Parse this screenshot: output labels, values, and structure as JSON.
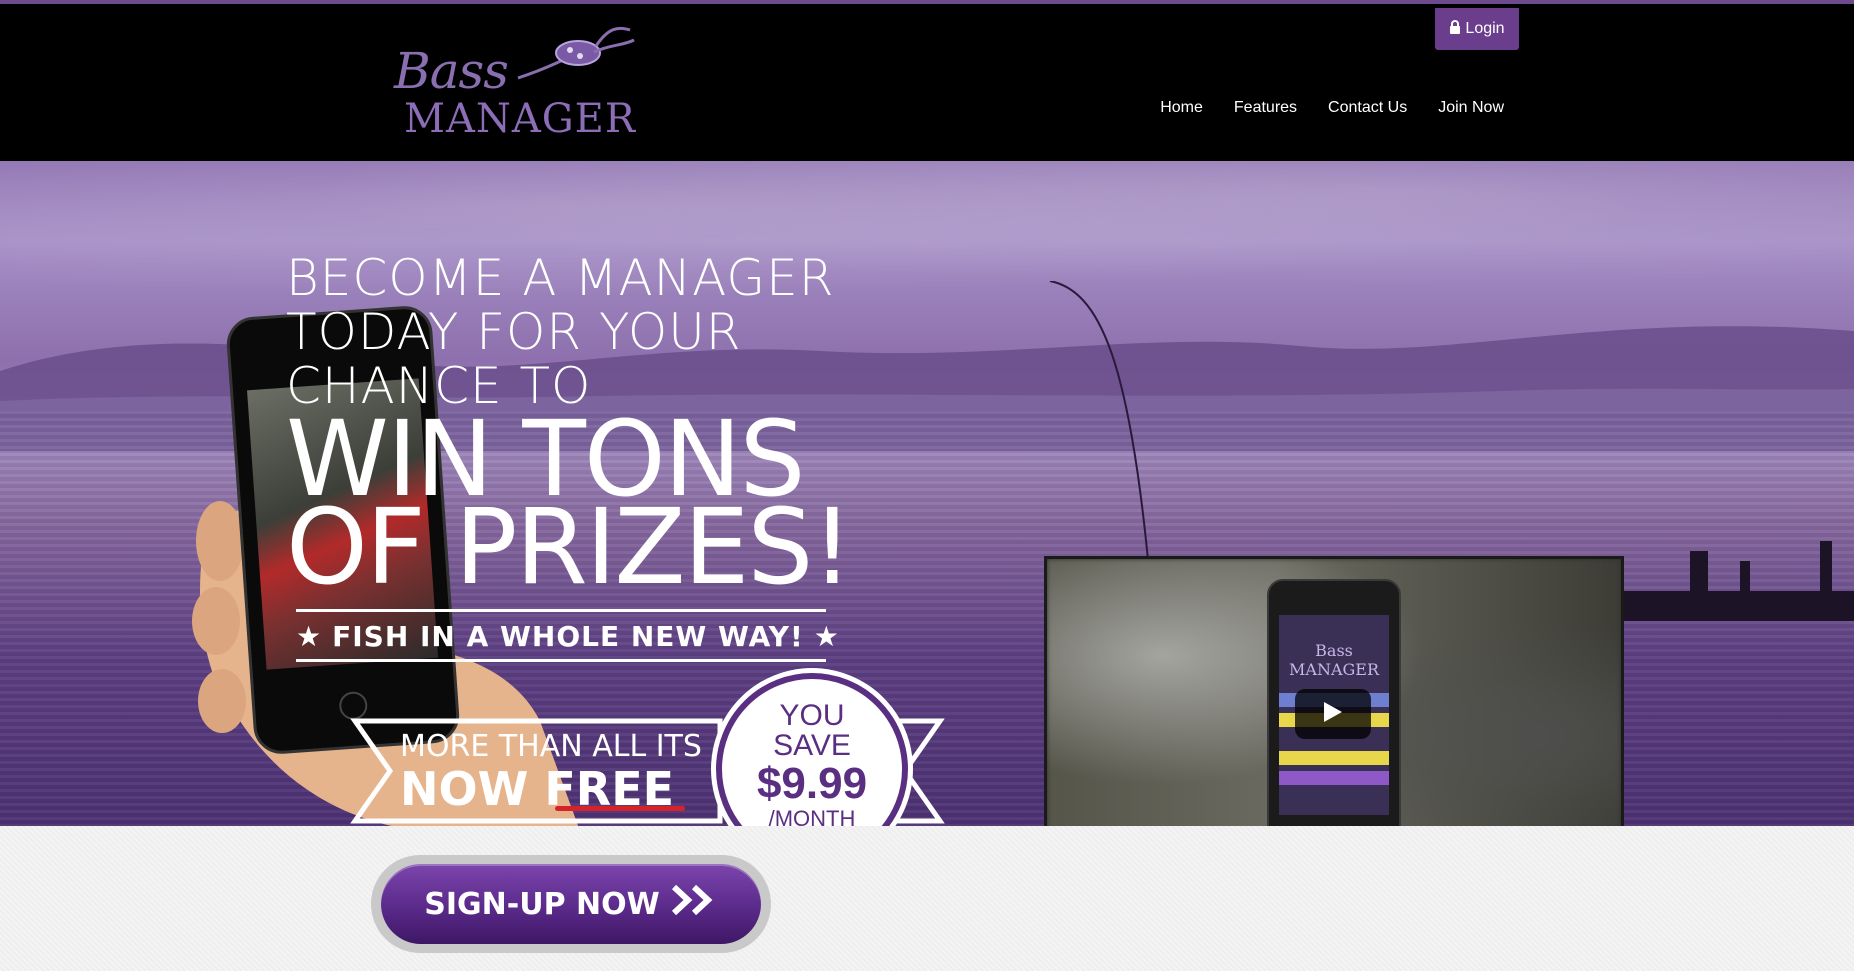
{
  "header": {
    "logo": {
      "line1": "Bass",
      "line2": "MANAGER"
    },
    "login_label": "Login",
    "nav": [
      "Home",
      "Features",
      "Contact Us",
      "Join Now"
    ]
  },
  "hero": {
    "headline_lines": [
      "BECOME A MANAGER",
      "TODAY FOR YOUR",
      "CHANCE TO"
    ],
    "headline_big": [
      "WIN TONS",
      "OF PRIZES!"
    ],
    "tagline": "FISH IN A WHOLE NEW WAY!",
    "ribbon_line1": "MORE THAN ALL ITS",
    "ribbon_line2": "NOW FREE",
    "badge": {
      "line1": "YOU",
      "line2": "SAVE",
      "price": "$9.99",
      "per": "/MONTH"
    },
    "video": {
      "phone_title": "Bass MANAGER"
    }
  },
  "cta": {
    "signup_label": "SIGN-UP NOW"
  },
  "colors": {
    "brand_purple": "#6a3d8d",
    "accent_red": "#d6232a"
  },
  "icons": {
    "login": "lock-icon",
    "play": "play-icon",
    "signup": "double-chevron-icon"
  }
}
